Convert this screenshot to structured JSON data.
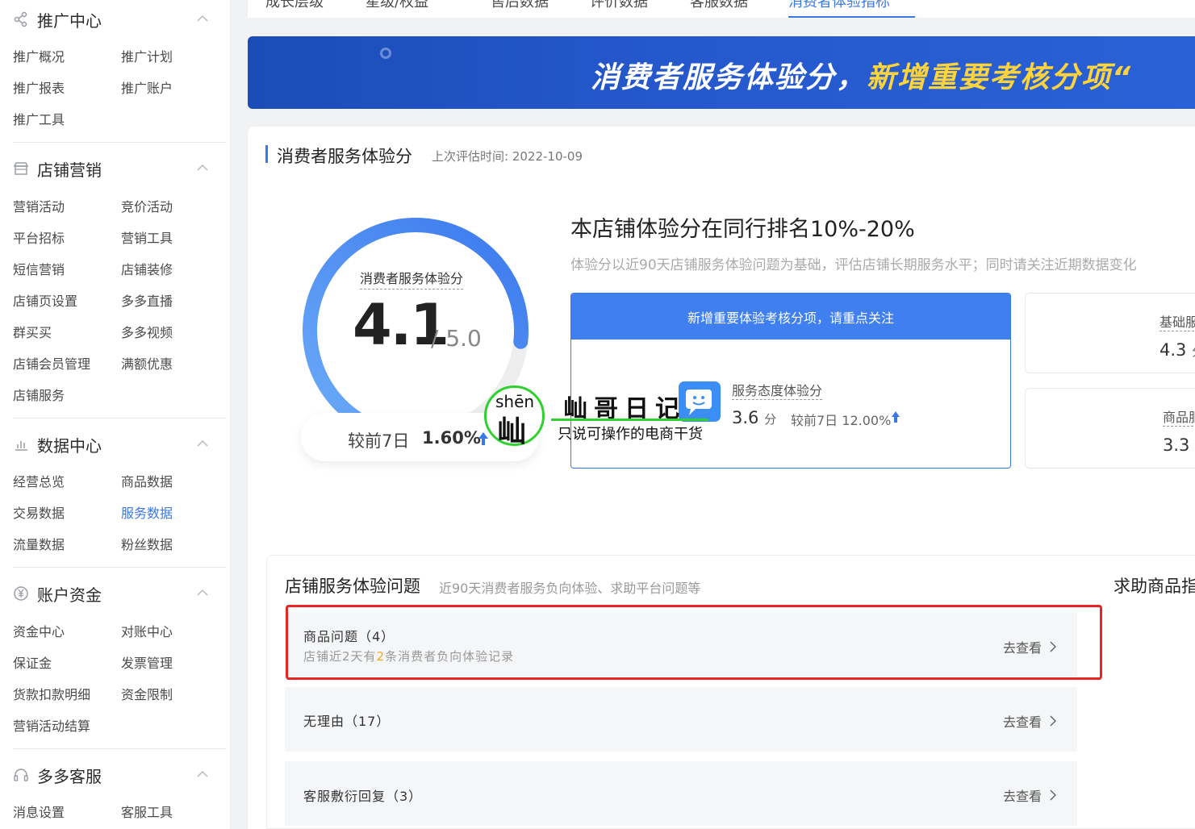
{
  "sidebar": {
    "sections": [
      {
        "title": "推广中心",
        "icon": "share-icon",
        "items": [
          "推广概况",
          "推广计划",
          "推广报表",
          "推广账户",
          "推广工具"
        ]
      },
      {
        "title": "店铺营销",
        "icon": "shop-icon",
        "items": [
          "营销活动",
          "竞价活动",
          "平台招标",
          "营销工具",
          "短信营销",
          "店铺装修",
          "店铺页设置",
          "多多直播",
          "群买买",
          "多多视频",
          "店铺会员管理",
          "满额优惠",
          "店铺服务"
        ]
      },
      {
        "title": "数据中心",
        "icon": "bar-chart-icon",
        "items": [
          "经营总览",
          "商品数据",
          "交易数据",
          "服务数据",
          "流量数据",
          "粉丝数据"
        ],
        "active": "服务数据"
      },
      {
        "title": "账户资金",
        "icon": "yen-icon",
        "items": [
          "资金中心",
          "对账中心",
          "保证金",
          "发票管理",
          "货款扣款明细",
          "资金限制",
          "营销活动结算"
        ]
      },
      {
        "title": "多多客服",
        "icon": "headset-icon",
        "items": [
          "消息设置",
          "客服工具"
        ]
      }
    ]
  },
  "tabs": [
    "成长层级",
    "星级/权益",
    "售后数据",
    "评价数据",
    "客服数据",
    "消费者体验指标"
  ],
  "active_tab": "消费者体验指标",
  "banner": {
    "text_white": "消费者服务体验分，",
    "text_yellow": "新增重要考核分项“"
  },
  "score": {
    "section_title": "消费者服务体验分",
    "eval_time": "上次评估时间: 2022-10-09",
    "gauge_label": "消费者服务体验分",
    "value": "4.1",
    "max": "/ 5.0",
    "gauge_fraction": 0.82,
    "compare_label": "较前7日",
    "compare_value": "1.60%",
    "rank_headline": "本店铺体验分在同行排名10%-20%",
    "rank_desc": "体验分以近90天店铺服务体验问题为基础，评估店铺长期服务水平；同时请关注近期数据变化"
  },
  "new_item": {
    "header": "新增重要体验考核分项，请重点关注",
    "label": "服务态度体验分",
    "value": "3.6",
    "unit": "分",
    "compare": "较前7日 12.00%"
  },
  "side_cards": [
    {
      "label": "基础服",
      "value": "4.3",
      "unit": "分"
    },
    {
      "label": "商品服",
      "value": "3.3",
      "unit": "分"
    }
  ],
  "issues": {
    "title": "店铺服务体验问题",
    "subtitle": "近90天消费者服务负向体验、求助平台问题等",
    "help_title": "求助商品指",
    "rows": [
      {
        "title": "商品问题（4）",
        "detail_pre": "店铺近2天有",
        "detail_num": "2",
        "detail_post": "条消费者负向体验记录",
        "link": "去查看"
      },
      {
        "title": "无理由（17）",
        "link": "去查看"
      },
      {
        "title": "客服敷衍回复（3）",
        "link": "去查看"
      }
    ]
  },
  "watermark": {
    "pinyin": "shēn",
    "char": "屾",
    "title": "屾哥日记",
    "subtitle": "只说可操作的电商干货"
  },
  "colors": {
    "accent": "#3a78e6",
    "highlight_orange": "#f5a623",
    "box_red": "#e82424",
    "watermark_green": "#2fd12f"
  }
}
